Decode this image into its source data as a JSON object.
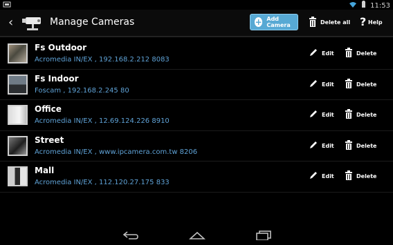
{
  "status": {
    "time": "11:53"
  },
  "action_bar": {
    "title": "Manage Cameras",
    "add_camera_label": "Add Camera",
    "delete_all_label": "Delete all",
    "help_label": "Help"
  },
  "cameras": [
    {
      "name": "Fs Outdoor",
      "brand": "Acromedia IN/EX",
      "host": "192.168.2.212",
      "port": "8083",
      "info": "Acromedia IN/EX ,  192.168.2.212  8083",
      "edit_label": "Edit",
      "delete_label": "Delete"
    },
    {
      "name": "Fs Indoor",
      "brand": "Foscam",
      "host": "192.168.2.245",
      "port": "80",
      "info": "Foscam ,  192.168.2.245  80",
      "edit_label": "Edit",
      "delete_label": "Delete"
    },
    {
      "name": "Office",
      "brand": "Acromedia IN/EX",
      "host": "12.69.124.226",
      "port": "8910",
      "info": "Acromedia IN/EX ,  12.69.124.226  8910",
      "edit_label": "Edit",
      "delete_label": "Delete"
    },
    {
      "name": "Street",
      "brand": "Acromedia IN/EX",
      "host": "www.ipcamera.com.tw",
      "port": "8206",
      "info": "Acromedia IN/EX ,  www.ipcamera.com.tw  8206",
      "edit_label": "Edit",
      "delete_label": "Delete"
    },
    {
      "name": "Mall",
      "brand": "Acromedia IN/EX",
      "host": "112.120.27.175",
      "port": "833",
      "info": "Acromedia IN/EX ,  112.120.27.175  833",
      "edit_label": "Edit",
      "delete_label": "Delete"
    }
  ],
  "colors": {
    "accent": "#57a9d4",
    "info_text": "#5fa2d6",
    "background": "#000000"
  },
  "icons": {
    "back": "back-chevron-icon",
    "app": "security-camera-icon",
    "add": "plus-circle-icon",
    "delete_all": "trash-icon",
    "help": "question-icon",
    "edit": "pencil-icon",
    "delete": "trash-icon"
  }
}
